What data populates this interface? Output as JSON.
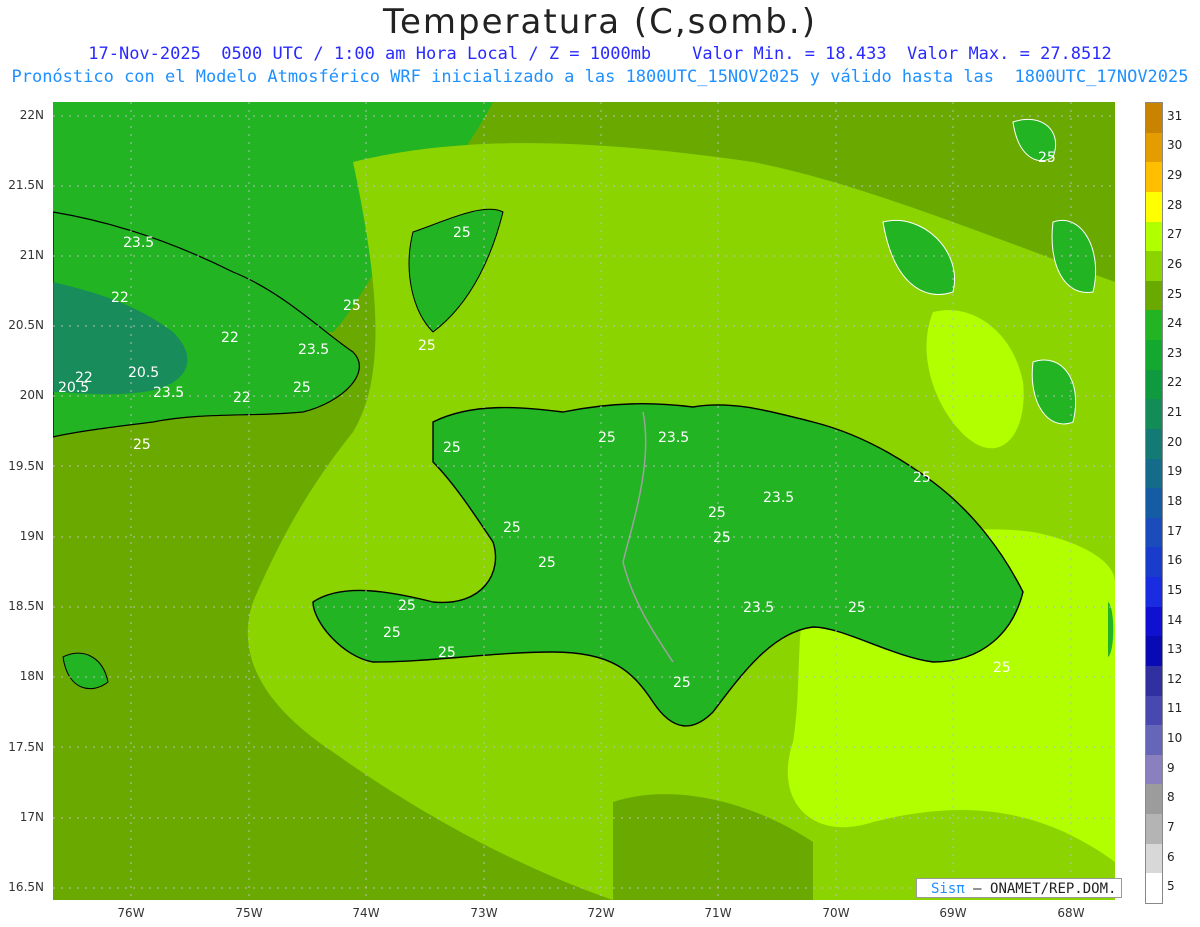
{
  "title": "Temperatura (C,somb.)",
  "subtitle_line1": "17-Nov-2025  0500 UTC / 1:00 am Hora Local / Z = 1000mb    Valor Min. = 18.433  Valor Max. = 27.8512",
  "subtitle_line2": "Pronóstico con el Modelo Atmosférico WRF inicializado a las 1800UTC_15NOV2025 y válido hasta las  1800UTC_17NOV2025",
  "lat_labels": [
    "22N",
    "21.5N",
    "21N",
    "20.5N",
    "20N",
    "19.5N",
    "19N",
    "18.5N",
    "18N",
    "17.5N",
    "17N",
    "16.5N"
  ],
  "lon_labels": [
    "76W",
    "75W",
    "74W",
    "73W",
    "72W",
    "71W",
    "70W",
    "69W",
    "68W"
  ],
  "colorbar": {
    "labels": [
      "31",
      "30",
      "29",
      "28",
      "27",
      "26",
      "25",
      "24",
      "23",
      "22",
      "21",
      "20",
      "19",
      "18",
      "17",
      "16",
      "15",
      "14",
      "13",
      "12",
      "11",
      "10",
      "9",
      "8",
      "7",
      "6",
      "5"
    ],
    "colors": [
      "#c88400",
      "#e59c00",
      "#ffbf00",
      "#ffff00",
      "#b2ff00",
      "#8cd400",
      "#6aaa00",
      "#22b422",
      "#13a830",
      "#0f9a40",
      "#138c58",
      "#147a74",
      "#156c8a",
      "#165ca4",
      "#1a4cbc",
      "#1a3ccc",
      "#1a2ce0",
      "#1010d0",
      "#0a0ab4",
      "#3030a0",
      "#4848b0",
      "#6666b8",
      "#8a80c0",
      "#9c9c9c",
      "#b4b4b4",
      "#d8d8d8",
      "#ffffff"
    ]
  },
  "contour_labels": [
    "23.5",
    "22",
    "22",
    "20.5",
    "22",
    "20.5",
    "23.5",
    "22",
    "23.5",
    "25",
    "25",
    "25",
    "25",
    "25",
    "25",
    "23.5",
    "25",
    "23.5",
    "25",
    "25",
    "25",
    "25",
    "25",
    "25",
    "25",
    "25",
    "23.5",
    "25",
    "25",
    "25",
    "25"
  ],
  "credit_sis": "Sisπ",
  "credit_rest": "— ONAMET/REP.DOM.",
  "colors": {
    "ocean_deep": "#22b422",
    "ocean_mid": "#6aaa00",
    "ocean_warm": "#8cd400",
    "warmest": "#b2ff00",
    "land_line": "#000000",
    "contour": "#ffffff",
    "border": "#a0a0a0"
  }
}
